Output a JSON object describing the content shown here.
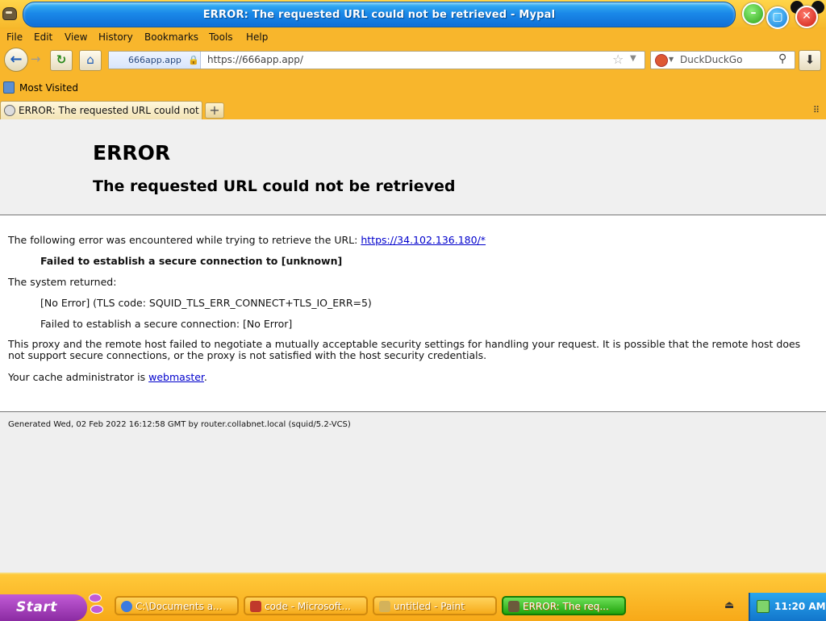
{
  "window": {
    "title": "ERROR: The requested URL could not be retrieved - Mypal"
  },
  "menu": [
    "File",
    "Edit",
    "View",
    "History",
    "Bookmarks",
    "Tools",
    "Help"
  ],
  "nav": {
    "identity": "666app.app",
    "url": "https://666app.app/",
    "search_placeholder": "DuckDuckGo"
  },
  "bookmarks": {
    "most_visited": "Most Visited"
  },
  "tabs": [
    {
      "label": "ERROR: The requested URL could not..."
    }
  ],
  "page": {
    "heading": "ERROR",
    "subheading": "The requested URL could not be retrieved",
    "intro": "The following error was encountered while trying to retrieve the URL:",
    "intro_link": "https://34.102.136.180/*",
    "error_bold": "Failed to establish a secure connection to [unknown]",
    "system_returned": "The system returned:",
    "sys_detail_1": "[No Error] (TLS code: SQUID_TLS_ERR_CONNECT+TLS_IO_ERR=5)",
    "sys_detail_2": "Failed to establish a secure connection: [No Error]",
    "explanation": "This proxy and the remote host failed to negotiate a mutually acceptable security settings for handling your request. It is possible that the remote host does not support secure connections, or the proxy is not satisfied with the host security credentials.",
    "admin_prefix": "Your cache administrator is",
    "admin_link": "webmaster",
    "admin_suffix": ".",
    "footer": "Generated Wed, 02 Feb 2022 16:12:58 GMT by router.collabnet.local (squid/5.2-VCS)"
  },
  "taskbar": {
    "start": "Start",
    "tasks": [
      {
        "label": "C:\\Documents a...",
        "active": false
      },
      {
        "label": "code - Microsoft...",
        "active": false
      },
      {
        "label": "untitled - Paint",
        "active": false
      },
      {
        "label": "ERROR: The req...",
        "active": true
      }
    ],
    "clock": "11:20 AM"
  },
  "colors": {
    "theme": "#f8b62c",
    "title_blue": "#1a88e8",
    "link": "#0000cc",
    "start_purple": "#8b2ba2",
    "active_task_green": "#20a40c"
  }
}
